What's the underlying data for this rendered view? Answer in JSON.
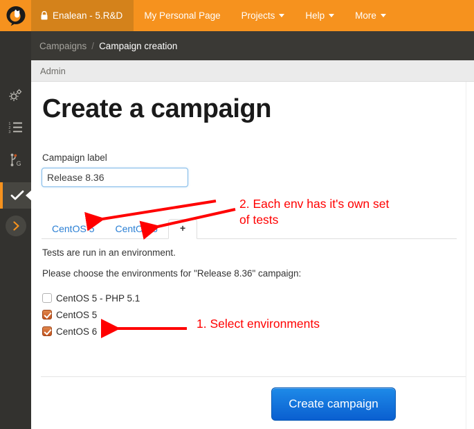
{
  "navbar": {
    "logo_name": "tuleap-logo",
    "project": {
      "label": "Enalean - 5.R&D",
      "icon": "lock-icon"
    },
    "items": [
      {
        "label": "My Personal Page",
        "has_caret": false
      },
      {
        "label": "Projects",
        "has_caret": true
      },
      {
        "label": "Help",
        "has_caret": true
      },
      {
        "label": "More",
        "has_caret": true
      }
    ]
  },
  "sidebar": {
    "items": [
      {
        "name": "gears-icon",
        "title": "Admin"
      },
      {
        "name": "ordered-list-icon",
        "title": "Trackers"
      },
      {
        "name": "git-icon",
        "title": "Git"
      },
      {
        "name": "check-icon",
        "title": "Test Management",
        "active": true
      }
    ],
    "expand_label": "chevron-right-icon"
  },
  "breadcrumb": {
    "parent": "Campaigns",
    "separator": "/",
    "current": "Campaign creation"
  },
  "admin_bar": {
    "label": "Admin"
  },
  "main": {
    "title": "Create a campaign",
    "field_label": "Campaign label",
    "field_value": "Release 8.36",
    "field_placeholder": "Campaign label",
    "tabs": [
      {
        "label": "CentOS 5",
        "active": false
      },
      {
        "label": "CentOS 6",
        "active": false
      },
      {
        "label": "+",
        "active": true
      }
    ],
    "intro_line": "Tests are run in an environment.",
    "choose_line": "Please choose the environments for \"Release 8.36\" campaign:",
    "environments": [
      {
        "label": "CentOS 5 - PHP 5.1",
        "checked": false
      },
      {
        "label": "CentOS 5",
        "checked": true
      },
      {
        "label": "CentOS 6",
        "checked": true
      }
    ],
    "submit_label": "Create campaign"
  },
  "annotations": [
    {
      "id": "annotation-2",
      "text": "2. Each env has it's own set\nof tests",
      "color": "#ff0000"
    },
    {
      "id": "annotation-1",
      "text": "1. Select environments",
      "color": "#ff0000"
    }
  ],
  "colors": {
    "brand_orange": "#f6921e",
    "project_orange": "#d4821b",
    "dark_chrome": "#33322f",
    "breadcrumb_dark": "#3a3935",
    "link_blue": "#2a7fd4",
    "button_blue": "#0a5fd0",
    "checkbox_orange": "#c4551f",
    "annotation_red": "#ff0000"
  }
}
